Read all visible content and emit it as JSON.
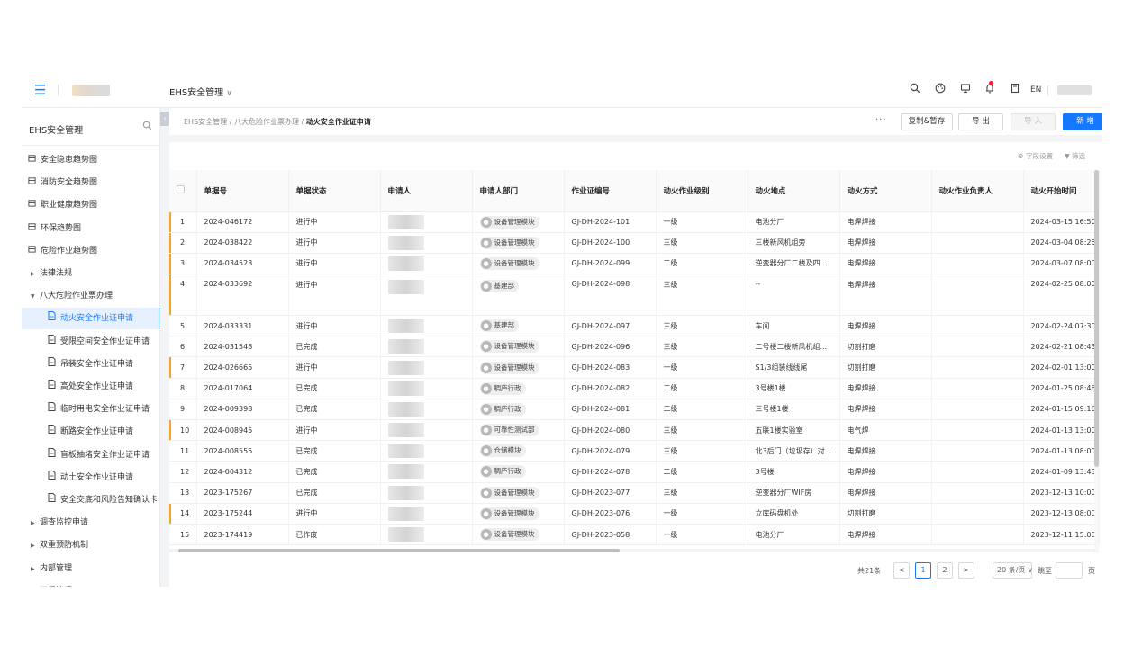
{
  "header": {
    "app_name": "EHS安全管理",
    "lang": "EN",
    "icons": [
      "search-icon",
      "palette-icon",
      "monitor-icon",
      "bell-icon",
      "document-icon"
    ]
  },
  "sidebar": {
    "title": "EHS安全管理",
    "items": [
      {
        "label": "安全隐患趋势图",
        "level": 0,
        "icon": "chart-icon"
      },
      {
        "label": "消防安全趋势图",
        "level": 0,
        "icon": "chart-icon"
      },
      {
        "label": "职业健康趋势图",
        "level": 0,
        "icon": "chart-icon"
      },
      {
        "label": "环保趋势图",
        "level": 0,
        "icon": "chart-icon"
      },
      {
        "label": "危险作业趋势图",
        "level": 0,
        "icon": "chart-icon"
      },
      {
        "label": "法律法规",
        "level": 1,
        "caret": "▶"
      },
      {
        "label": "八大危险作业票办理",
        "level": 1,
        "caret": "▼"
      },
      {
        "label": "动火安全作业证申请",
        "level": 2,
        "icon": "doc-icon",
        "active": true
      },
      {
        "label": "受限空间安全作业证申请",
        "level": 2,
        "icon": "doc-icon"
      },
      {
        "label": "吊装安全作业证申请",
        "level": 2,
        "icon": "doc-icon"
      },
      {
        "label": "高处安全作业证申请",
        "level": 2,
        "icon": "doc-icon"
      },
      {
        "label": "临时用电安全作业证申请",
        "level": 2,
        "icon": "doc-icon"
      },
      {
        "label": "断路安全作业证申请",
        "level": 2,
        "icon": "doc-icon"
      },
      {
        "label": "盲板抽堵安全作业证申请",
        "level": 2,
        "icon": "doc-icon"
      },
      {
        "label": "动土安全作业证申请",
        "level": 2,
        "icon": "doc-icon"
      },
      {
        "label": "安全交底和风险告知确认卡",
        "level": 2,
        "icon": "doc-icon"
      },
      {
        "label": "调查监控申请",
        "level": 1,
        "caret": "▶"
      },
      {
        "label": "双重预防机制",
        "level": 1,
        "caret": "▶"
      },
      {
        "label": "内部管理",
        "level": 1,
        "caret": "▶"
      },
      {
        "label": "环保管理",
        "level": 1,
        "caret": "▶"
      }
    ]
  },
  "breadcrumb": {
    "items": [
      "EHS安全管理",
      "八大危险作业票办理"
    ],
    "current": "动火安全作业证申请",
    "separator": "/"
  },
  "toolbar": {
    "more": "···",
    "copy_save": "复制&暂存",
    "export": "导 出",
    "import": "导 入",
    "new": "新 增"
  },
  "table_tools": {
    "field_settings": "字段设置",
    "filter": "筛选"
  },
  "table": {
    "columns": [
      "单据号",
      "单据状态",
      "申请人",
      "申请人部门",
      "作业证编号",
      "动火作业级别",
      "动火地点",
      "动火方式",
      "动火作业负责人",
      "动火开始时间"
    ],
    "rows": [
      {
        "idx": "1",
        "no": "2024-046172",
        "status": "进行中",
        "dept": "设备管理模块",
        "cert": "GJ-DH-2024-101",
        "level": "一级",
        "place": "电池分厂",
        "method": "电焊焊接",
        "owner": "",
        "start": "2024-03-15 16:50",
        "mark": true
      },
      {
        "idx": "2",
        "no": "2024-038422",
        "status": "进行中",
        "dept": "设备管理模块",
        "cert": "GJ-DH-2024-100",
        "level": "三级",
        "place": "三楼新风机组旁",
        "method": "电焊焊接",
        "owner": "",
        "start": "2024-03-04 08:25",
        "mark": true
      },
      {
        "idx": "3",
        "no": "2024-034523",
        "status": "进行中",
        "dept": "设备管理模块",
        "cert": "GJ-DH-2024-099",
        "level": "二级",
        "place": "逆变器分厂二楼及四...",
        "method": "电焊焊接",
        "owner": "",
        "start": "2024-03-07 08:00",
        "mark": true
      },
      {
        "idx": "4",
        "no": "2024-033692",
        "status": "进行中",
        "dept": "基建部",
        "cert": "GJ-DH-2024-098",
        "level": "三级",
        "place": "--",
        "method": "电焊焊接",
        "owner": "",
        "start": "2024-02-25 08:00",
        "mark": true,
        "tall": true
      },
      {
        "idx": "5",
        "no": "2024-033331",
        "status": "进行中",
        "dept": "基建部",
        "cert": "GJ-DH-2024-097",
        "level": "三级",
        "place": "车间",
        "method": "电焊焊接",
        "owner": "",
        "start": "2024-02-24 07:30",
        "mark": false
      },
      {
        "idx": "6",
        "no": "2024-031548",
        "status": "已完成",
        "dept": "设备管理模块",
        "cert": "GJ-DH-2024-096",
        "level": "三级",
        "place": "二号楼二楼新风机组...",
        "method": "切割打磨",
        "owner": "",
        "start": "2024-02-21 08:43",
        "mark": false
      },
      {
        "idx": "7",
        "no": "2024-026665",
        "status": "进行中",
        "dept": "设备管理模块",
        "cert": "GJ-DH-2024-083",
        "level": "一级",
        "place": "S1/3组装线线尾",
        "method": "切割打磨",
        "owner": "",
        "start": "2024-02-01 13:00",
        "mark": true
      },
      {
        "idx": "8",
        "no": "2024-017064",
        "status": "已完成",
        "dept": "稠庐行政",
        "cert": "GJ-DH-2024-082",
        "level": "二级",
        "place": "3号楼1楼",
        "method": "电焊焊接",
        "owner": "",
        "start": "2024-01-25 08:46",
        "mark": false
      },
      {
        "idx": "9",
        "no": "2024-009398",
        "status": "已完成",
        "dept": "稠庐行政",
        "cert": "GJ-DH-2024-081",
        "level": "二级",
        "place": "三号楼1楼",
        "method": "电焊焊接",
        "owner": "",
        "start": "2024-01-15 09:16",
        "mark": false
      },
      {
        "idx": "10",
        "no": "2024-008945",
        "status": "进行中",
        "dept": "可靠性测试部",
        "cert": "GJ-DH-2024-080",
        "level": "三级",
        "place": "五联1楼实验室",
        "method": "电气焊",
        "owner": "",
        "start": "2024-01-13 13:00",
        "mark": true
      },
      {
        "idx": "11",
        "no": "2024-008555",
        "status": "已完成",
        "dept": "仓储模块",
        "cert": "GJ-DH-2024-079",
        "level": "三级",
        "place": "北3后门（垃圾存）对...",
        "method": "电焊焊接",
        "owner": "",
        "start": "2024-01-13 08:00",
        "mark": false
      },
      {
        "idx": "12",
        "no": "2024-004312",
        "status": "已完成",
        "dept": "稠庐行政",
        "cert": "GJ-DH-2024-078",
        "level": "二级",
        "place": "3号楼",
        "method": "电焊焊接",
        "owner": "",
        "start": "2024-01-09 13:43",
        "mark": false
      },
      {
        "idx": "13",
        "no": "2023-175267",
        "status": "已完成",
        "dept": "设备管理模块",
        "cert": "GJ-DH-2023-077",
        "level": "三级",
        "place": "逆变器分厂WIF房",
        "method": "电焊焊接",
        "owner": "",
        "start": "2023-12-13 10:00",
        "mark": false
      },
      {
        "idx": "14",
        "no": "2023-175244",
        "status": "进行中",
        "dept": "设备管理模块",
        "cert": "GJ-DH-2023-076",
        "level": "一级",
        "place": "立库码盘机处",
        "method": "切割打磨",
        "owner": "",
        "start": "2023-12-13 08:00",
        "mark": true
      },
      {
        "idx": "15",
        "no": "2023-174419",
        "status": "已作废",
        "dept": "设备管理模块",
        "cert": "GJ-DH-2023-058",
        "level": "一级",
        "place": "电池分厂",
        "method": "电焊焊接",
        "owner": "",
        "start": "2023-12-11 15:00",
        "mark": false
      }
    ]
  },
  "pagination": {
    "total": "共21条",
    "prev": "<",
    "pages": [
      "1",
      "2"
    ],
    "current": "1",
    "next": ">",
    "page_size": "20 条/页",
    "jump_label": "跳至",
    "page_unit": "页"
  },
  "colors": {
    "primary": "#1677ff",
    "row_marker": "#f5a623",
    "notify": "#f5222d"
  }
}
